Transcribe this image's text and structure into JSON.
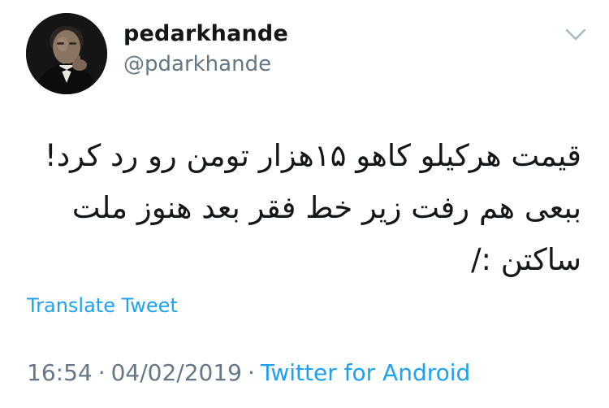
{
  "tweet": {
    "user": {
      "display_name": "pedarkhande",
      "handle": "@pdarkhande"
    },
    "text_lines": [
      "قیمت هرکیلو کاهو ۱۵هزار تومن رو رد کرد!",
      "ببعی هم رفت زیر خط فقر بعد هنوز ملت",
      "ساکتن :/"
    ],
    "translate_label": "Translate Tweet",
    "time": "16:54",
    "date": "04/02/2019",
    "separator": "·",
    "source": "Twitter for Android"
  },
  "icons": {
    "avatar": "profile-photo",
    "menu": "chevron-down-icon"
  },
  "colors": {
    "text": "#14171a",
    "secondary": "#657786",
    "link": "#1da1f2"
  }
}
